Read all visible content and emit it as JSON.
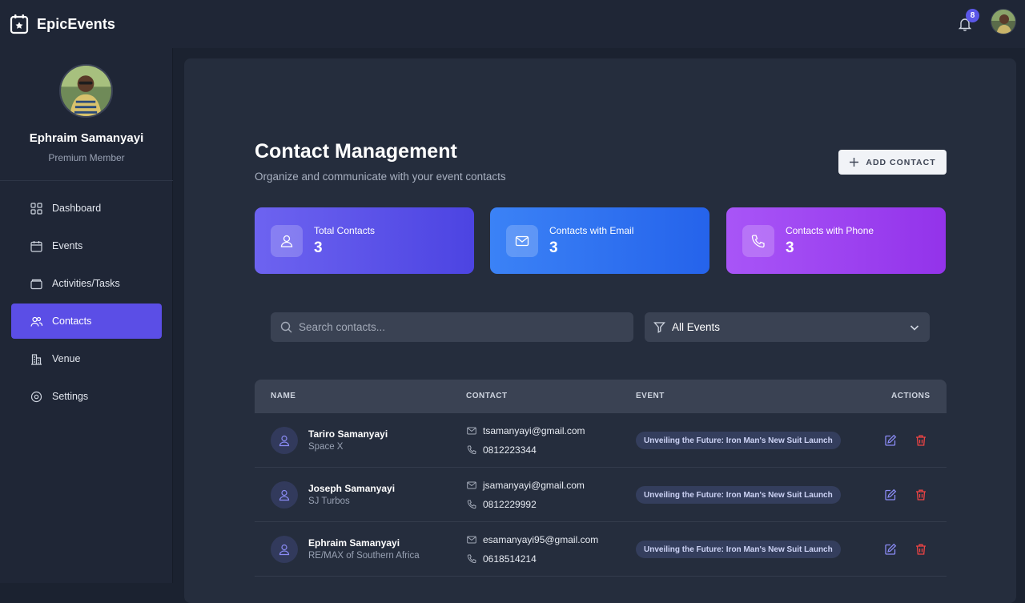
{
  "app": {
    "name": "EpicEvents",
    "notification_count": "8"
  },
  "user": {
    "name": "Ephraim Samanyayi",
    "role": "Premium Member"
  },
  "nav": [
    {
      "label": "Dashboard",
      "icon": "grid-icon"
    },
    {
      "label": "Events",
      "icon": "calendar-icon"
    },
    {
      "label": "Activities/Tasks",
      "icon": "folder-icon"
    },
    {
      "label": "Contacts",
      "icon": "users-icon",
      "active": true
    },
    {
      "label": "Venue",
      "icon": "building-icon"
    },
    {
      "label": "Settings",
      "icon": "gear-icon"
    }
  ],
  "page": {
    "title": "Contact Management",
    "subtitle": "Organize and communicate with your event contacts",
    "add_label": "ADD CONTACT"
  },
  "stats": [
    {
      "label": "Total Contacts",
      "value": "3",
      "icon": "user-icon"
    },
    {
      "label": "Contacts with Email",
      "value": "3",
      "icon": "mail-icon"
    },
    {
      "label": "Contacts with Phone",
      "value": "3",
      "icon": "phone-icon"
    }
  ],
  "search": {
    "placeholder": "Search contacts..."
  },
  "filter": {
    "selected": "All Events"
  },
  "table": {
    "headers": {
      "name": "NAME",
      "contact": "CONTACT",
      "event": "EVENT",
      "actions": "ACTIONS"
    },
    "rows": [
      {
        "name": "Tariro Samanyayi",
        "company": "Space X",
        "email": "tsamanyayi@gmail.com",
        "phone": "0812223344",
        "event": "Unveiling the Future: Iron Man's New Suit Launch"
      },
      {
        "name": "Joseph Samanyayi",
        "company": "SJ Turbos",
        "email": "jsamanyayi@gmail.com",
        "phone": "0812229992",
        "event": "Unveiling the Future: Iron Man's New Suit Launch"
      },
      {
        "name": "Ephraim Samanyayi",
        "company": "RE/MAX of Southern Africa",
        "email": "esamanyayi95@gmail.com",
        "phone": "0618514214",
        "event": "Unveiling the Future: Iron Man's New Suit Launch"
      }
    ]
  },
  "colors": {
    "accent": "#5b4ee6",
    "delete": "#ef4444",
    "edit": "#8b8cf6"
  }
}
